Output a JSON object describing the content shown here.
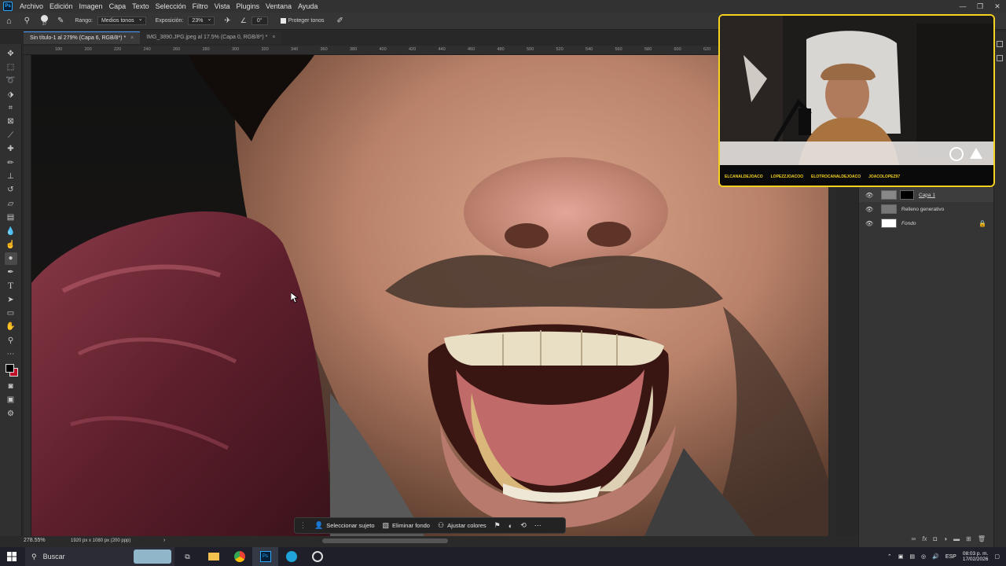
{
  "menu": {
    "items": [
      "Archivo",
      "Edición",
      "Imagen",
      "Capa",
      "Texto",
      "Selección",
      "Filtro",
      "Vista",
      "Plugins",
      "Ventana",
      "Ayuda"
    ],
    "window_controls": [
      "—",
      "❐",
      "✕"
    ]
  },
  "options": {
    "brush_size": "37",
    "range_label": "Rango:",
    "range_value": "Medios tonos",
    "exposure_label": "Exposición:",
    "exposure_value": "23%",
    "angle_value": "0°",
    "protect_label": "Proteger tonos"
  },
  "tabs": [
    {
      "label": "Sin título-1 al 279% (Capa 6, RGB/8*) *",
      "close": "×"
    },
    {
      "label": "IMG_3890.JPG.jpeg al 17.5% (Capa 0, RGB/8*) *",
      "close": "×"
    }
  ],
  "ruler": {
    "ticks": [
      "180",
      "200",
      "220",
      "240",
      "260",
      "280",
      "300",
      "320",
      "340",
      "360",
      "380",
      "400",
      "420",
      "440",
      "460",
      "480",
      "500",
      "520",
      "540",
      "560",
      "580",
      "600",
      "620",
      "640",
      "660",
      "680",
      "700"
    ]
  },
  "context_bar": {
    "select_subject": "Seleccionar sujeto",
    "remove_bg": "Eliminar fondo",
    "adjust_colors": "Ajustar colores"
  },
  "status": {
    "zoom": "278.55%",
    "doc_info": "1920 px x 1080 px (200 ppp)"
  },
  "layers": [
    {
      "name": "Capa 1",
      "locked": false
    },
    {
      "name": "Relleno generativo",
      "locked": false
    },
    {
      "name": "Fondo",
      "locked": true
    }
  ],
  "webcam": {
    "handles": [
      "ELCANALDEJOACO",
      "LOPEZZJOACOO",
      "ELOTROCANALDEJOACO",
      "JOACOLOPEZ97"
    ]
  },
  "taskbar": {
    "search_placeholder": "Buscar",
    "lang": "ESP",
    "time": "08:03 p. m.",
    "date": "17/02/2026"
  },
  "colors": {
    "accent": "#31a8ff",
    "webcam_border": "#f4d21f",
    "bg_swatch": "#c0102a"
  }
}
